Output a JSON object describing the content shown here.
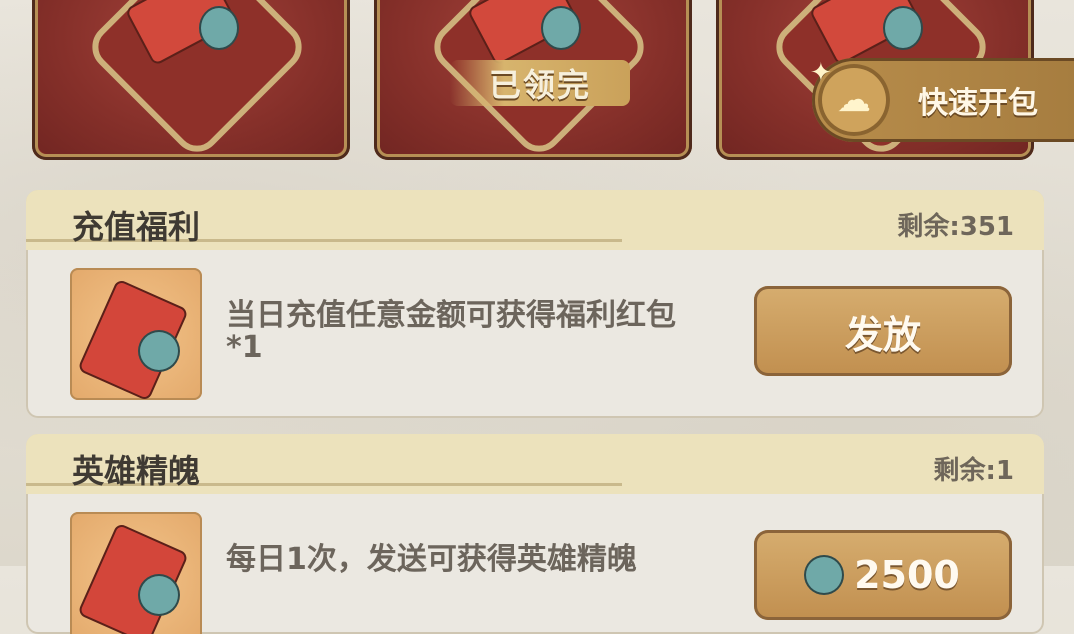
{
  "top_cards": [
    {
      "state": "available"
    },
    {
      "state": "done",
      "banner": "已领完"
    },
    {
      "state": "available"
    }
  ],
  "quick_open": {
    "label": "快速开包"
  },
  "panels": [
    {
      "title": "充值福利",
      "remaining": "剩余:351",
      "desc": "当日充值任意金额可获得福利红包*1",
      "button": "发放"
    },
    {
      "title": "英雄精魄",
      "remaining": "剩余:1",
      "desc": "每日1次，发送可获得英雄精魄",
      "button": "2500"
    }
  ]
}
